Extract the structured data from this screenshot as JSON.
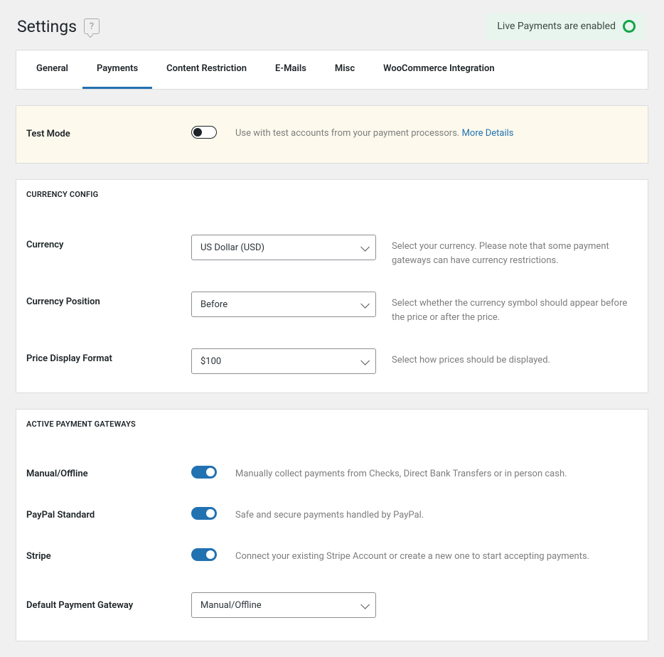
{
  "header": {
    "title": "Settings",
    "help_glyph": "?",
    "status_text": "Live Payments are enabled"
  },
  "tabs": [
    {
      "label": "General",
      "active": false
    },
    {
      "label": "Payments",
      "active": true
    },
    {
      "label": "Content Restriction",
      "active": false
    },
    {
      "label": "E-Mails",
      "active": false
    },
    {
      "label": "Misc",
      "active": false
    },
    {
      "label": "WooCommerce Integration",
      "active": false
    }
  ],
  "test_mode": {
    "label": "Test Mode",
    "enabled": false,
    "description": "Use with test accounts from your payment processors. ",
    "link_text": "More Details"
  },
  "currency_config": {
    "title": "Currency Config",
    "currency": {
      "label": "Currency",
      "value": "US Dollar (USD)",
      "description": "Select your currency. Please note that some payment gateways can have currency restrictions."
    },
    "position": {
      "label": "Currency Position",
      "value": "Before",
      "description": "Select whether the currency symbol should appear before the price or after the price."
    },
    "format": {
      "label": "Price Display Format",
      "value": "$100",
      "description": "Select how prices should be displayed."
    }
  },
  "gateways": {
    "title": "Active Payment Gateways",
    "items": [
      {
        "label": "Manual/Offline",
        "enabled": true,
        "description": "Manually collect payments from Checks, Direct Bank Transfers or in person cash."
      },
      {
        "label": "PayPal Standard",
        "enabled": true,
        "description": "Safe and secure payments handled by PayPal."
      },
      {
        "label": "Stripe",
        "enabled": true,
        "description": "Connect your existing Stripe Account or create a new one to start accepting payments."
      }
    ],
    "default_label": "Default Payment Gateway",
    "default_value": "Manual/Offline"
  }
}
